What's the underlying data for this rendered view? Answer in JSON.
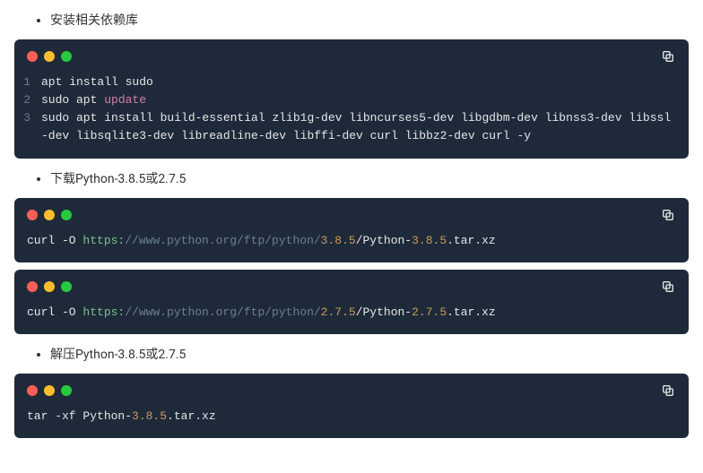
{
  "bullets": {
    "b1": "安装相关依赖库",
    "b2": "下载Python-3.8.5或2.7.5",
    "b3": "解压Python-3.8.5或2.7.5"
  },
  "code1": {
    "line1_num": "1",
    "line1_text": "apt install sudo",
    "line2_num": "2",
    "line2_pre": "sudo apt ",
    "line2_kw": "update",
    "line3_num": "3",
    "line3_text": "sudo apt install build-essential zlib1g-dev libncurses5-dev libgdbm-dev libnss3-dev libssl-dev libsqlite3-dev libreadline-dev libffi-dev curl libbz2-dev curl -y"
  },
  "code2": {
    "pre": "curl -O ",
    "scheme": "https:",
    "host": "//www.python.org/ftp/python/",
    "ver": "3.8.5",
    "file_pre": "/Python-",
    "file_ver": "3.8.5",
    "file_ext": ".tar.xz"
  },
  "code3": {
    "pre": "curl -O ",
    "scheme": "https:",
    "host": "//www.python.org/ftp/python/",
    "ver": "2.7.5",
    "file_pre": "/Python-",
    "file_ver": "2.7.5",
    "file_ext": ".tar.xz"
  },
  "code4": {
    "pre": "tar -xf Python-",
    "ver": "3.8.5",
    "ext": ".tar.xz"
  },
  "icons": {
    "copy": "copy-icon"
  }
}
